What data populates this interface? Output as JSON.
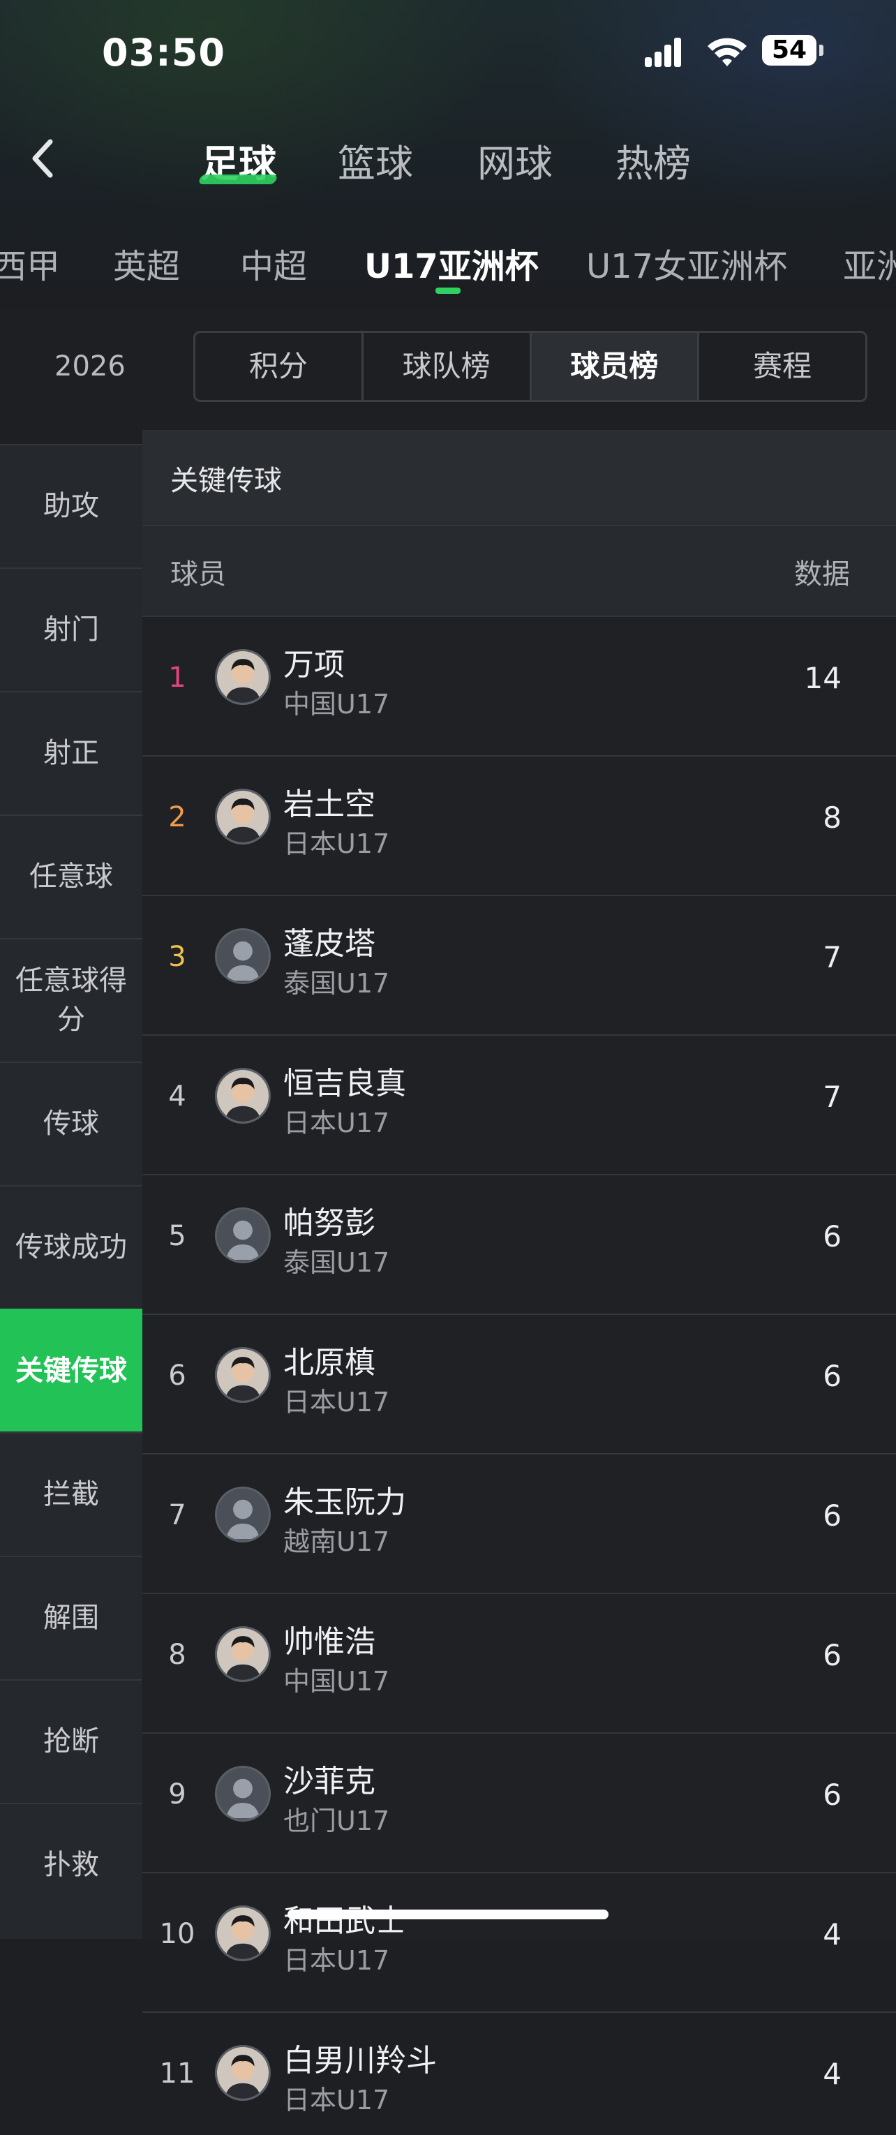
{
  "status_bar": {
    "time": "03:50",
    "battery": "54"
  },
  "sport_tabs": [
    {
      "label": "足球",
      "active": true
    },
    {
      "label": "篮球",
      "active": false
    },
    {
      "label": "网球",
      "active": false
    },
    {
      "label": "热榜",
      "active": false
    }
  ],
  "league_tabs": [
    {
      "label": "西甲"
    },
    {
      "label": "英超"
    },
    {
      "label": "中超"
    },
    {
      "label": "U17亚洲杯",
      "active": true
    },
    {
      "label": "U17女亚洲杯"
    },
    {
      "label": "亚洲"
    }
  ],
  "season": "2026",
  "segments": [
    {
      "label": "积分"
    },
    {
      "label": "球队榜"
    },
    {
      "label": "球员榜",
      "active": true
    },
    {
      "label": "赛程"
    }
  ],
  "sidebar": [
    {
      "label": "助攻"
    },
    {
      "label": "射门"
    },
    {
      "label": "射正"
    },
    {
      "label": "任意球"
    },
    {
      "label": "任意球得分"
    },
    {
      "label": "传球"
    },
    {
      "label": "传球成功"
    },
    {
      "label": "关键传球",
      "active": true
    },
    {
      "label": "拦截"
    },
    {
      "label": "解围"
    },
    {
      "label": "抢断"
    },
    {
      "label": "扑救"
    }
  ],
  "table": {
    "title": "关键传球",
    "col_player": "球员",
    "col_data": "数据",
    "rows": [
      {
        "rank": "1",
        "name": "万项",
        "team": "中国U17",
        "value": "14",
        "rank_color": "#e0467c",
        "avatar": "photo"
      },
      {
        "rank": "2",
        "name": "岩土空",
        "team": "日本U17",
        "value": "8",
        "rank_color": "#f19a4b",
        "avatar": "photo"
      },
      {
        "rank": "3",
        "name": "蓬皮塔",
        "team": "泰国U17",
        "value": "7",
        "rank_color": "#f1c24b",
        "avatar": "placeholder"
      },
      {
        "rank": "4",
        "name": "恒吉良真",
        "team": "日本U17",
        "value": "7",
        "rank_color": "#c9cbce",
        "avatar": "photo"
      },
      {
        "rank": "5",
        "name": "帕努彭",
        "team": "泰国U17",
        "value": "6",
        "rank_color": "#c9cbce",
        "avatar": "placeholder"
      },
      {
        "rank": "6",
        "name": "北原槙",
        "team": "日本U17",
        "value": "6",
        "rank_color": "#c9cbce",
        "avatar": "photo"
      },
      {
        "rank": "7",
        "name": "朱玉阮力",
        "team": "越南U17",
        "value": "6",
        "rank_color": "#c9cbce",
        "avatar": "placeholder"
      },
      {
        "rank": "8",
        "name": "帅惟浩",
        "team": "中国U17",
        "value": "6",
        "rank_color": "#c9cbce",
        "avatar": "photo"
      },
      {
        "rank": "9",
        "name": "沙菲克",
        "team": "也门U17",
        "value": "6",
        "rank_color": "#c9cbce",
        "avatar": "placeholder"
      },
      {
        "rank": "10",
        "name": "和田武士",
        "team": "日本U17",
        "value": "4",
        "rank_color": "#c9cbce",
        "avatar": "photo"
      },
      {
        "rank": "11",
        "name": "白男川羚斗",
        "team": "日本U17",
        "value": "4",
        "rank_color": "#c9cbce",
        "avatar": "photo"
      }
    ]
  }
}
